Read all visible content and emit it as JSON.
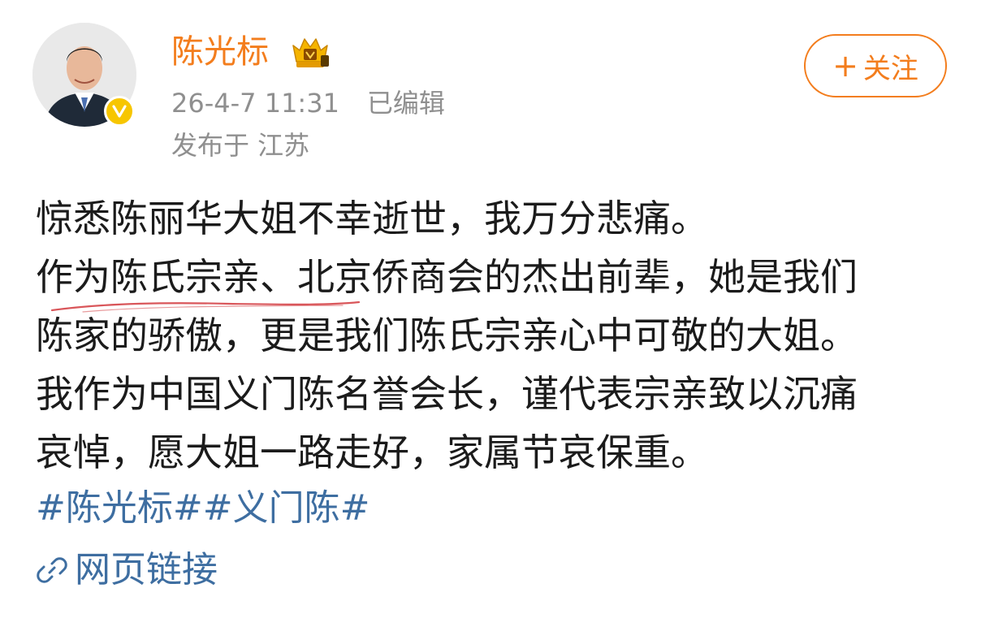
{
  "post": {
    "username": "陈光标",
    "timestamp": "26-4-7 11:31",
    "edited_label": "已编辑",
    "location": "发布于 江苏",
    "follow_plus": "+",
    "follow_label": "关注",
    "content_lines": [
      "惊悉陈丽华大姐不幸逝世，我万分悲痛。",
      "作为陈氏宗亲、北京侨商会的杰出前辈，她是我们",
      "陈家的骄傲，更是我们陈氏宗亲心中可敬的大姐。",
      "我作为中国义门陈名誉会长，谨代表宗亲致以沉痛",
      "哀悼，愿大姐一路走好，家属节哀保重。"
    ],
    "hashtags": [
      "#陈光标#",
      "#义门陈#"
    ],
    "web_link_label": "网页链接"
  },
  "icons": {
    "avatar": "avatar",
    "verified": "verified-badge-icon",
    "vip": "vip-crown-icon",
    "link": "link-icon"
  },
  "colors": {
    "username": "#f37d1d",
    "meta": "#8f8f8f",
    "text": "#1b1b1b",
    "link": "#3e6ea1",
    "verified_badge": "#f7c600",
    "underline": "#d9565a"
  }
}
